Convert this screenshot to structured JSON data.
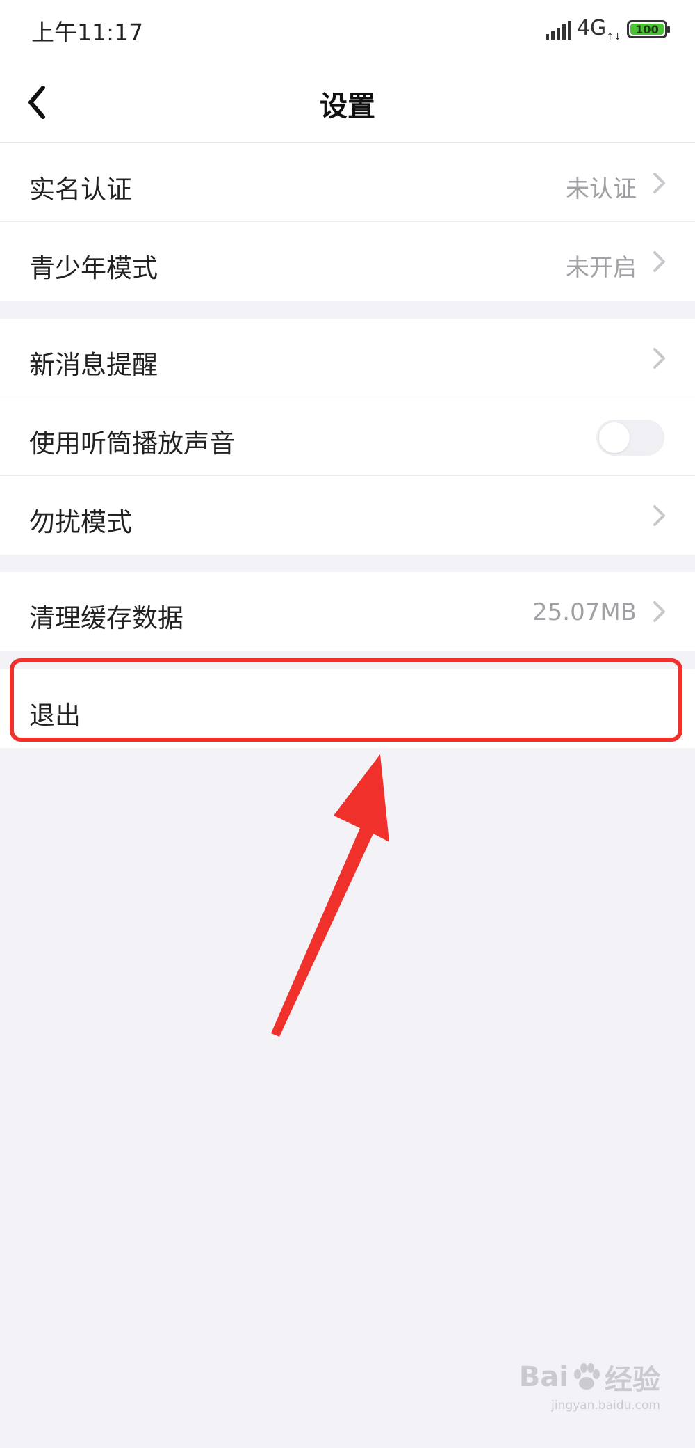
{
  "status_bar": {
    "time": "上午11:17",
    "network": "4G",
    "battery": "100"
  },
  "nav": {
    "title": "设置"
  },
  "groups": [
    {
      "items": [
        {
          "label": "实名认证",
          "value": "未认证"
        },
        {
          "label": "青少年模式",
          "value": "未开启"
        }
      ]
    },
    {
      "items": [
        {
          "label": "新消息提醒"
        },
        {
          "label": "使用听筒播放声音",
          "toggle_on": false
        },
        {
          "label": "勿扰模式"
        }
      ]
    },
    {
      "items": [
        {
          "label": "清理缓存数据",
          "value": "25.07MB"
        }
      ]
    },
    {
      "items": [
        {
          "label": "退出"
        }
      ]
    }
  ],
  "annotation": {
    "color": "#f0302a"
  },
  "watermark": {
    "main": "Bai",
    "main2": "经验",
    "sub": "jingyan.baidu.com"
  }
}
